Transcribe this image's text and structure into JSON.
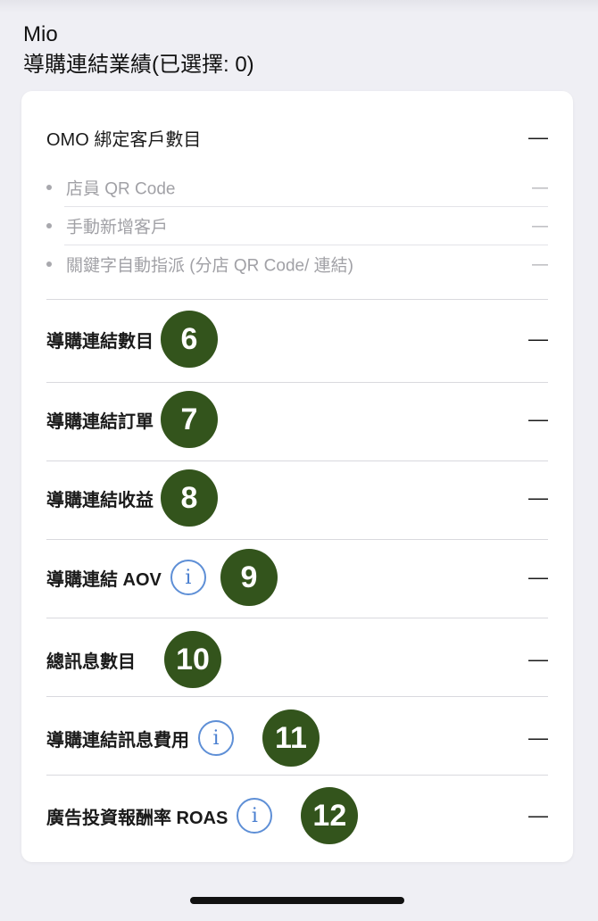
{
  "header": {
    "user_name": "Mio",
    "section_title": "導購連結業績(已選擇: 0)"
  },
  "omo": {
    "title": "OMO 綁定客戶數目",
    "value": "—",
    "sub_items": [
      {
        "label": "店員 QR Code",
        "value": "—"
      },
      {
        "label": "手動新增客戶",
        "value": "—"
      },
      {
        "label": "關鍵字自動指派 (分店 QR Code/ 連結)",
        "value": "—"
      }
    ]
  },
  "metrics": [
    {
      "label": "導購連結數目",
      "value": "—",
      "badge": "6",
      "info": false
    },
    {
      "label": "導購連結訂單",
      "value": "—",
      "badge": "7",
      "info": false
    },
    {
      "label": "導購連結收益",
      "value": "—",
      "badge": "8",
      "info": false
    },
    {
      "label": "導購連結 AOV",
      "value": "—",
      "badge": "9",
      "info": true
    },
    {
      "label": "總訊息數目",
      "value": "—",
      "badge": "10",
      "info": false
    },
    {
      "label": "導購連結訊息費用",
      "value": "—",
      "badge": "11",
      "info": true
    },
    {
      "label": "廣告投資報酬率 ROAS",
      "value": "—",
      "badge": "12",
      "info": true
    }
  ],
  "colors": {
    "background": "#efeff4",
    "card": "#ffffff",
    "badge": "#33541c",
    "info_icon": "#4a7fd0",
    "divider": "#d9d9de"
  },
  "icons": {
    "info": "i"
  }
}
